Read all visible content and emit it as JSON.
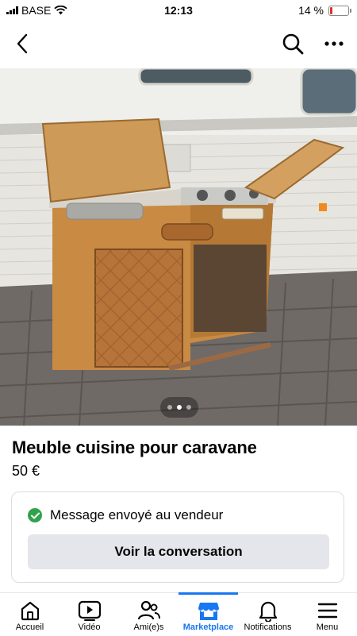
{
  "status_bar": {
    "carrier": "BASE",
    "time": "12:13",
    "battery": "14 %",
    "battery_level": 0.14
  },
  "listing": {
    "title": "Meuble cuisine pour caravane",
    "price": "50 €",
    "photo_count": 3,
    "active_photo": 2
  },
  "message_card": {
    "status_text": "Message envoyé au vendeur",
    "button_label": "Voir la conversation"
  },
  "tabs": [
    {
      "label": "Accueil",
      "icon": "home-icon"
    },
    {
      "label": "Vidéo",
      "icon": "video-icon"
    },
    {
      "label": "Ami(e)s",
      "icon": "friends-icon"
    },
    {
      "label": "Marketplace",
      "icon": "marketplace-icon",
      "active": true
    },
    {
      "label": "Notifications",
      "icon": "bell-icon"
    },
    {
      "label": "Menu",
      "icon": "menu-icon"
    }
  ],
  "colors": {
    "accent": "#1877f2",
    "success": "#31a24c",
    "battery_low": "#e0302b"
  }
}
